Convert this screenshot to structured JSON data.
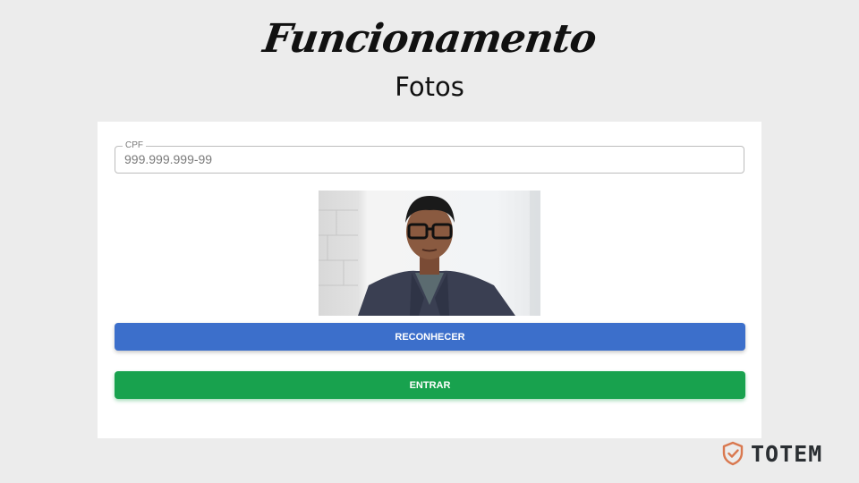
{
  "slide": {
    "title": "Funcionamento",
    "subtitle": "Fotos"
  },
  "form": {
    "cpf_label": "CPF",
    "cpf_placeholder": "999.999.999-99",
    "recognize_label": "RECONHECER",
    "enter_label": "ENTRAR"
  },
  "colors": {
    "recognize_button": "#3c6fcb",
    "enter_button": "#18a24e",
    "brand_icon": "#d9784f"
  },
  "brand": {
    "name": "TOTEM",
    "icon": "shield-check-icon"
  }
}
